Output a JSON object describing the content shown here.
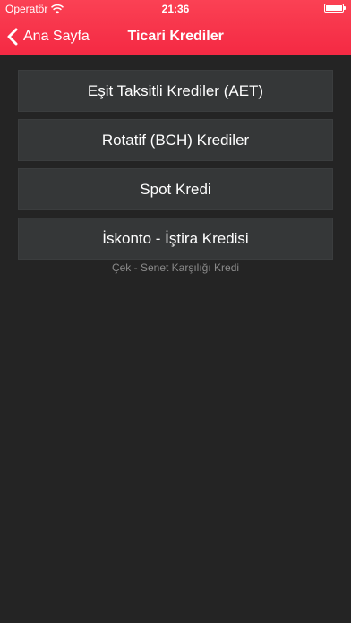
{
  "status_bar": {
    "carrier": "Operatör",
    "time": "21:36",
    "battery_level": 1.0
  },
  "nav": {
    "back_label": "Ana Sayfa",
    "title": "Ticari Krediler"
  },
  "menu": {
    "items": [
      {
        "label": "Eşit Taksitli Krediler (AET)"
      },
      {
        "label": "Rotatif (BCH) Krediler"
      },
      {
        "label": "Spot Kredi"
      },
      {
        "label": "İskonto - İştira Kredisi"
      }
    ],
    "footnote": "Çek - Senet Karşılığı Kredi"
  },
  "colors": {
    "accent": "#f42943",
    "background": "#242424",
    "button_bg": "#353738"
  },
  "icons": {
    "back": "chevron-left-icon",
    "wifi": "wifi-icon",
    "battery": "battery-icon"
  }
}
